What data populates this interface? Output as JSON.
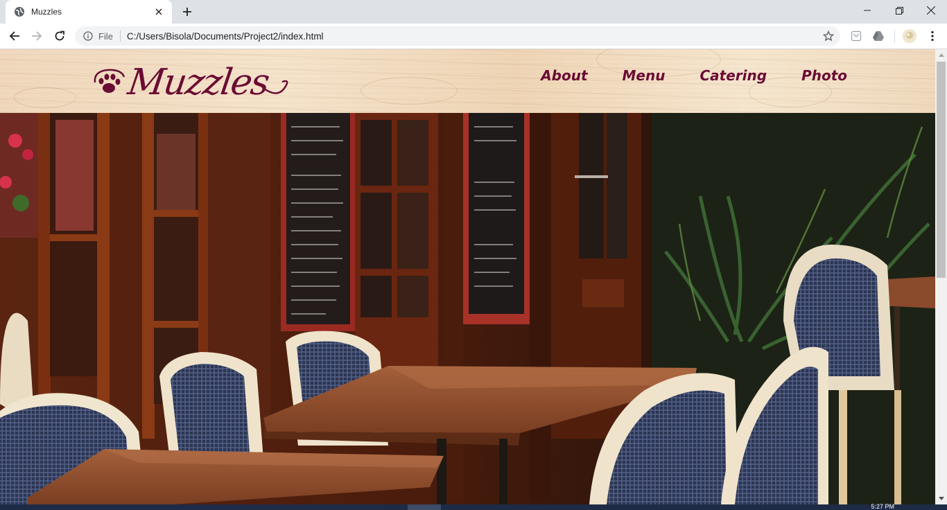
{
  "browser": {
    "tab": {
      "title": "Muzzles"
    },
    "address_bar": {
      "scheme_label": "File",
      "url": "C:/Users/Bisola/Documents/Project2/index.html"
    },
    "icons": [
      "globe-icon",
      "close-icon",
      "plus-icon",
      "minimize-icon",
      "restore-icon",
      "back-icon",
      "forward-icon",
      "reload-icon",
      "info-icon",
      "star-icon",
      "extension-icon",
      "drive-icon",
      "profile-avatar",
      "menu-icon"
    ]
  },
  "site": {
    "logo_text": "Muzzles",
    "nav": [
      {
        "label": "About"
      },
      {
        "label": "Menu"
      },
      {
        "label": "Catering"
      },
      {
        "label": "Photo"
      }
    ],
    "colors": {
      "brand": "#6a0c34",
      "header_wood": "#f2ddc3"
    }
  },
  "taskbar": {
    "clock": "5:27 PM"
  }
}
